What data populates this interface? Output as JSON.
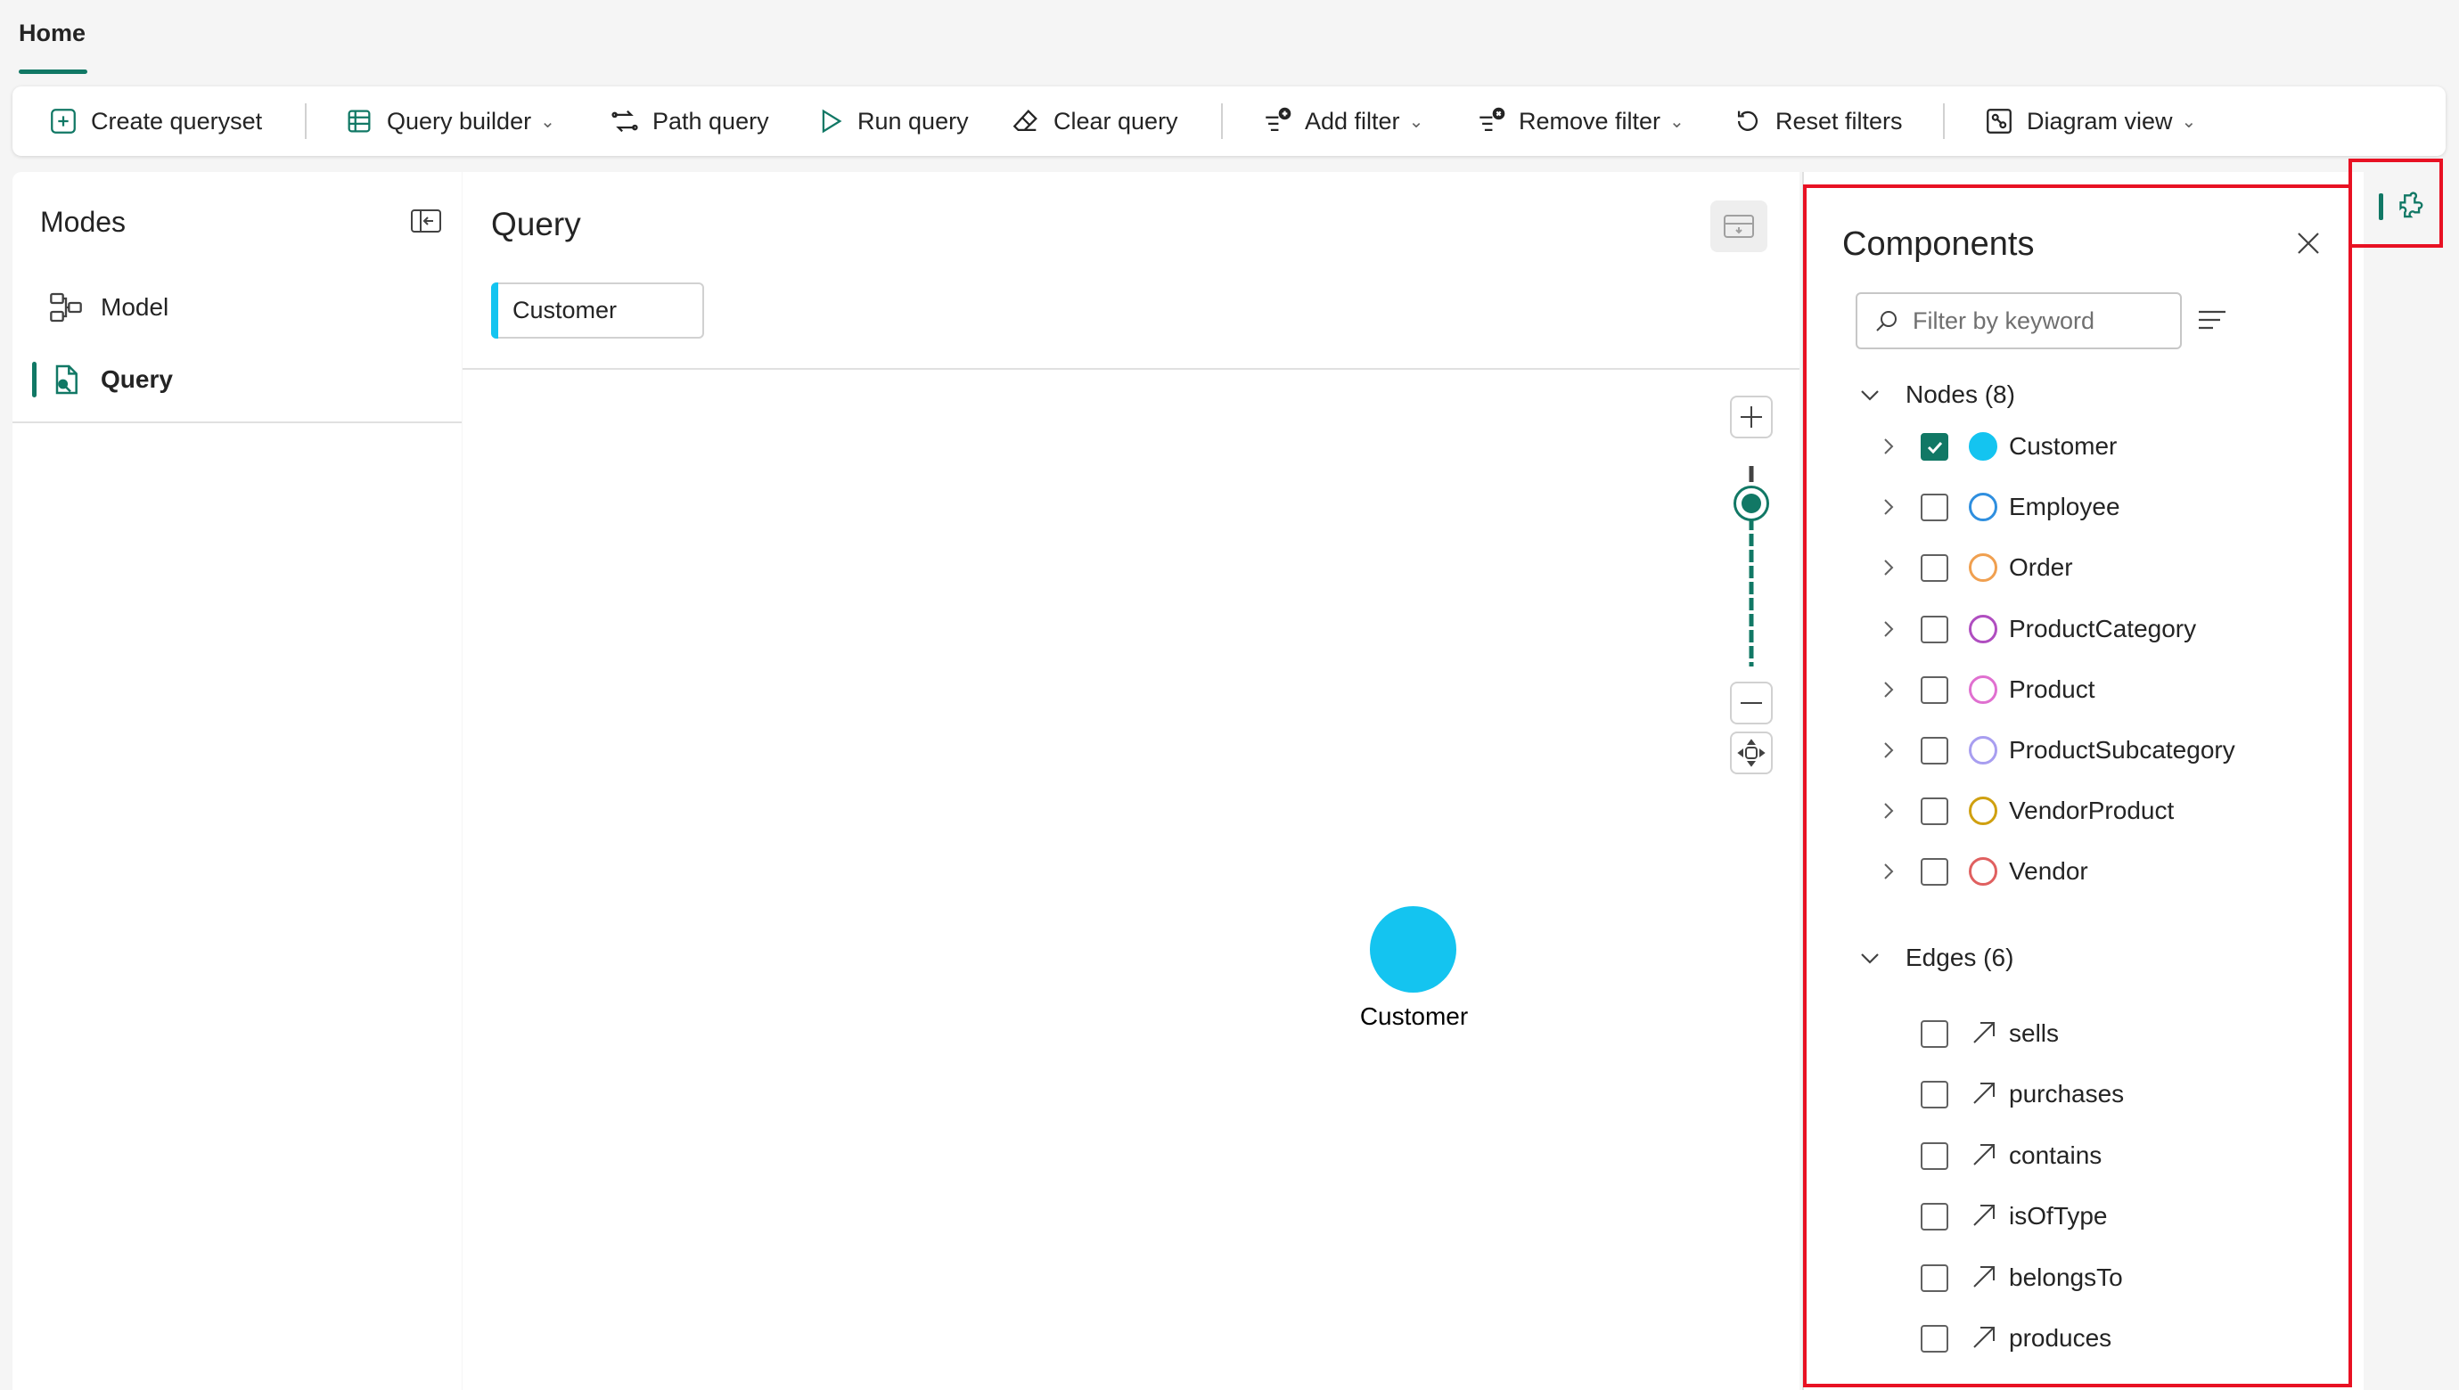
{
  "ribbon": {
    "active_tab": "Home"
  },
  "toolbar": {
    "create_queryset": "Create queryset",
    "query_builder": "Query builder",
    "path_query": "Path query",
    "run_query": "Run query",
    "clear_query": "Clear query",
    "add_filter": "Add filter",
    "remove_filter": "Remove filter",
    "reset_filters": "Reset filters",
    "diagram_view": "Diagram view"
  },
  "modes": {
    "title": "Modes",
    "items": [
      {
        "label": "Model",
        "active": false
      },
      {
        "label": "Query",
        "active": true
      }
    ]
  },
  "query": {
    "title": "Query",
    "chip": "Customer",
    "graph_node": {
      "label": "Customer",
      "color": "#14c4f0"
    }
  },
  "components": {
    "title": "Components",
    "search_placeholder": "Filter by keyword",
    "nodes_header": "Nodes (8)",
    "edges_header": "Edges (6)",
    "nodes": [
      {
        "label": "Customer",
        "checked": true,
        "color": "#14c4f0",
        "filled": true
      },
      {
        "label": "Employee",
        "checked": false,
        "color": "#2f8fdf",
        "filled": false
      },
      {
        "label": "Order",
        "checked": false,
        "color": "#f0a050",
        "filled": false
      },
      {
        "label": "ProductCategory",
        "checked": false,
        "color": "#b04ec0",
        "filled": false
      },
      {
        "label": "Product",
        "checked": false,
        "color": "#e070d0",
        "filled": false
      },
      {
        "label": "ProductSubcategory",
        "checked": false,
        "color": "#a89ef0",
        "filled": false
      },
      {
        "label": "VendorProduct",
        "checked": false,
        "color": "#d0a010",
        "filled": false
      },
      {
        "label": "Vendor",
        "checked": false,
        "color": "#e06060",
        "filled": false
      }
    ],
    "edges": [
      {
        "label": "sells",
        "checked": false
      },
      {
        "label": "purchases",
        "checked": false
      },
      {
        "label": "contains",
        "checked": false
      },
      {
        "label": "isOfType",
        "checked": false
      },
      {
        "label": "belongsTo",
        "checked": false
      },
      {
        "label": "produces",
        "checked": false
      }
    ]
  },
  "colors": {
    "accent": "#117865",
    "highlight": "#e81123"
  }
}
